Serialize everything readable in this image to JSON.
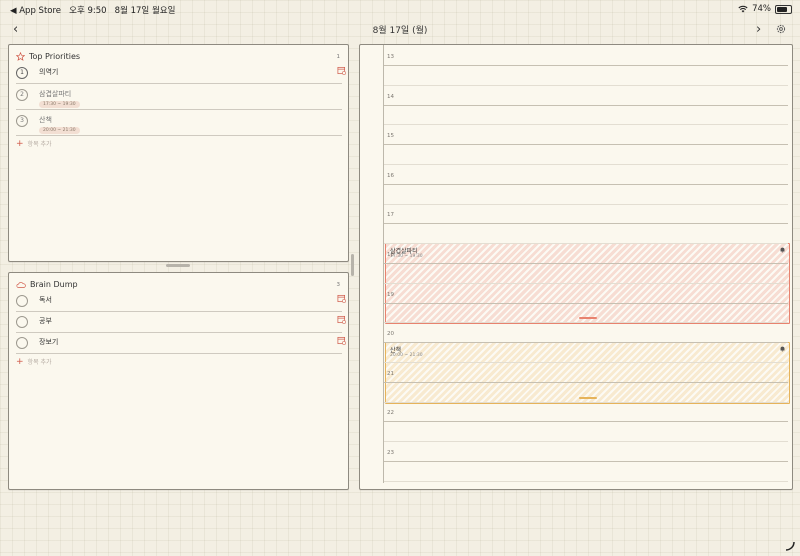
{
  "status": {
    "back_app": "◀ App Store",
    "time": "오후 9:50",
    "date": "8월 17일 월요일",
    "battery": "74%",
    "battery_level": 0.74
  },
  "header": {
    "title": "8월 17일 (월)"
  },
  "priorities": {
    "title": "Top Priorities",
    "count": "1",
    "items": [
      {
        "num": "1",
        "text": "의역기"
      },
      {
        "num": "2",
        "text": "삼겹살파티",
        "time": "17:30 ~ 19:30"
      },
      {
        "num": "3",
        "text": "산책",
        "time": "20:00 ~ 21:30"
      }
    ],
    "add_label": "항목 추가"
  },
  "brain_dump": {
    "title": "Brain Dump",
    "count": "3",
    "items": [
      {
        "text": "독서"
      },
      {
        "text": "공부"
      },
      {
        "text": "장보기"
      }
    ],
    "add_label": "항목 추가"
  },
  "timeline": {
    "hours": [
      "13",
      "14",
      "15",
      "16",
      "17",
      "18",
      "19",
      "20",
      "21",
      "22",
      "23"
    ],
    "events": [
      {
        "title": "삼겹살파티",
        "time": "17:30 ~ 19:30",
        "color": "#e8826e",
        "fill": "#f7ddd3"
      },
      {
        "title": "산책",
        "time": "20:00 ~ 21:30",
        "color": "#e6b35a",
        "fill": "#f8ead0"
      }
    ]
  },
  "colors": {
    "accent": "#d05a4a",
    "background": "#f3efe3",
    "card": "#fbf8ee"
  }
}
